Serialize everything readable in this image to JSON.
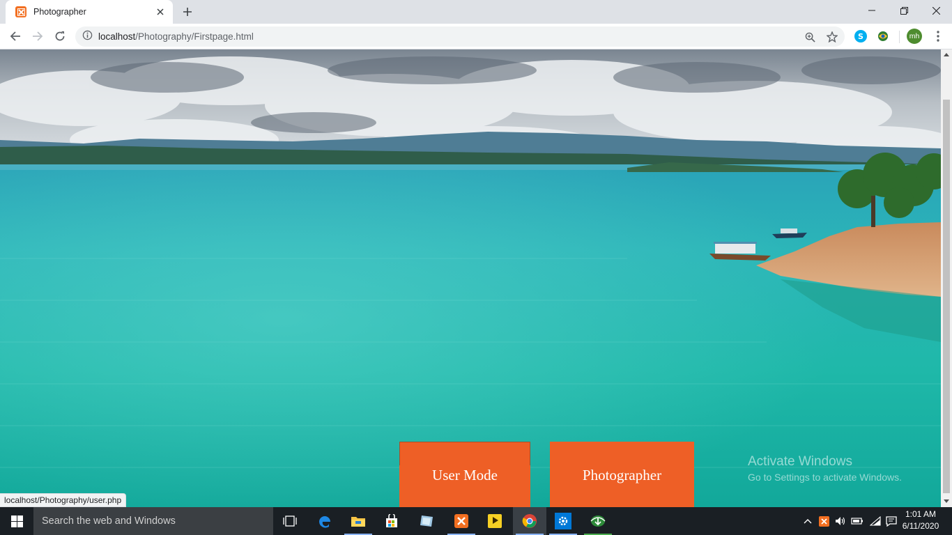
{
  "browser": {
    "tab": {
      "title": "Photographer"
    },
    "address": {
      "host": "localhost",
      "path": "/Photography/Firstpage.html"
    },
    "profile_initials": "mh",
    "status_url": "localhost/Photography/user.php"
  },
  "page": {
    "buttons": {
      "user_mode": "User Mode",
      "photographer": "Photographer"
    },
    "button_color": "#ee5f26"
  },
  "watermark": {
    "title": "Activate Windows",
    "subtitle": "Go to Settings to activate Windows."
  },
  "taskbar": {
    "search_placeholder": "Search the web and Windows",
    "time": "1:01 AM",
    "date": "6/11/2020",
    "apps": [
      "task-view",
      "edge",
      "file-explorer",
      "store",
      "app",
      "xampp",
      "kmplayer",
      "chrome",
      "settings",
      "idm"
    ]
  }
}
